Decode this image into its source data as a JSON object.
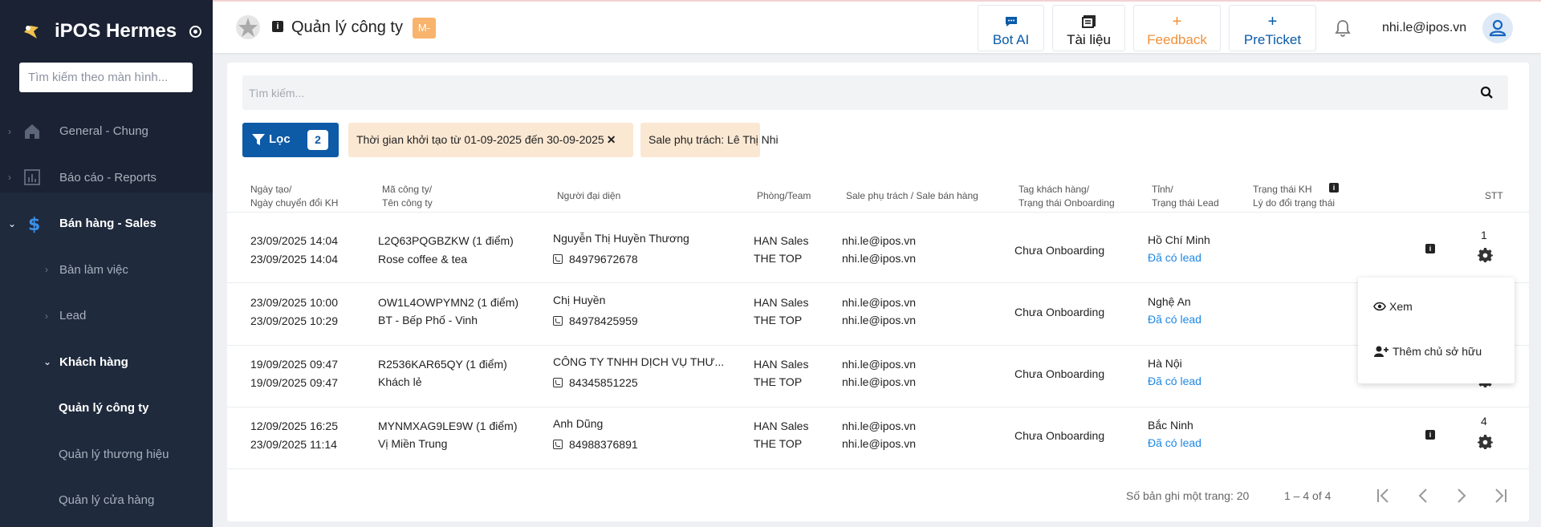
{
  "sidebar": {
    "brand": "iPOS Hermes",
    "search_placeholder": "Tìm kiếm theo màn hình...",
    "items": [
      {
        "label": "General - Chung"
      },
      {
        "label": "Báo cáo - Reports"
      },
      {
        "label": "Bán hàng - Sales"
      },
      {
        "label": "Bàn làm việc"
      },
      {
        "label": "Lead"
      },
      {
        "label": "Khách hàng"
      },
      {
        "label": "Quản lý công ty"
      },
      {
        "label": "Quản lý thương hiệu"
      },
      {
        "label": "Quản lý cửa hàng"
      }
    ]
  },
  "header": {
    "title": "Quản lý công ty",
    "badge": "M-",
    "buttons": {
      "bot": "Bot AI",
      "tai": "Tài liệu",
      "feedback": "Feedback",
      "preticket": "PreTicket"
    },
    "user_email": "nhi.le@ipos.vn"
  },
  "search": {
    "placeholder": "Tìm kiếm..."
  },
  "filter": {
    "label": "Lọc",
    "count": "2",
    "chips": [
      "Thời gian khởi tạo từ 01-09-2025 đến 30-09-2025",
      "Sale phụ trách: Lê Thị Nhi"
    ]
  },
  "table": {
    "headers": {
      "date_1": "Ngày tạo/",
      "date_2": "Ngày chuyển đổi KH",
      "code_1": "Mã công ty/",
      "code_2": "Tên công ty",
      "rep": "Người đại diện",
      "team": "Phòng/Team",
      "sale": "Sale phụ trách / Sale bán hàng",
      "tag_1": "Tag khách hàng/",
      "tag_2": "Trạng thái Onboarding",
      "prov_1": "Tỉnh/",
      "prov_2": "Trạng thái Lead",
      "status_1": "Trạng thái KH",
      "status_2": "Lý do đổi trạng thái",
      "stt": "STT"
    },
    "rows": [
      {
        "created": "23/09/2025 14:04",
        "converted": "23/09/2025 14:04",
        "code": "L2Q63PQGBZKW (1 điểm)",
        "name": "Rose coffee & tea",
        "rep": "Nguyễn Thị Huyền Thương",
        "phone": "84979672678",
        "team1": "HAN Sales",
        "team2": "THE TOP",
        "sale1": "nhi.le@ipos.vn",
        "sale2": "nhi.le@ipos.vn",
        "onboarding": "Chưa Onboarding",
        "province": "Hồ Chí Minh",
        "lead": "Đã có lead",
        "stt": "1"
      },
      {
        "created": "23/09/2025 10:00",
        "converted": "23/09/2025 10:29",
        "code": "OW1L4OWPYMN2 (1 điểm)",
        "name": "BT - Bếp Phố - Vinh",
        "rep": "Chị Huyền",
        "phone": "84978425959",
        "team1": "HAN Sales",
        "team2": "THE TOP",
        "sale1": "nhi.le@ipos.vn",
        "sale2": "nhi.le@ipos.vn",
        "onboarding": "Chưa Onboarding",
        "province": "Nghệ An",
        "lead": "Đã có lead",
        "stt": ""
      },
      {
        "created": "19/09/2025 09:47",
        "converted": "19/09/2025 09:47",
        "code": "R2536KAR65QY (1 điểm)",
        "name": "Khách lẻ",
        "rep": "CÔNG TY TNHH DỊCH VỤ THƯ...",
        "phone": "84345851225",
        "team1": "HAN Sales",
        "team2": "THE TOP",
        "sale1": "nhi.le@ipos.vn",
        "sale2": "nhi.le@ipos.vn",
        "onboarding": "Chưa Onboarding",
        "province": "Hà Nội",
        "lead": "Đã có lead",
        "stt": ""
      },
      {
        "created": "12/09/2025 16:25",
        "converted": "23/09/2025 11:14",
        "code": "MYNMXAG9LE9W (1 điểm)",
        "name": "Vị Miền Trung",
        "rep": "Anh Dũng",
        "phone": "84988376891",
        "team1": "HAN Sales",
        "team2": "THE TOP",
        "sale1": "nhi.le@ipos.vn",
        "sale2": "nhi.le@ipos.vn",
        "onboarding": "Chưa Onboarding",
        "province": "Bắc Ninh",
        "lead": "Đã có lead",
        "stt": "4"
      }
    ]
  },
  "menu": {
    "view": "Xem",
    "add_owner": "Thêm chủ sở hữu"
  },
  "pagination": {
    "per_page": "Số bản ghi một trang: 20",
    "range": "1 – 4 of 4"
  },
  "colors": {
    "sidebar": "#1a2233",
    "primary": "#0d5aa7",
    "chip": "#fbe8d3",
    "link": "#1e88e5",
    "feedback": "#f0913a"
  }
}
